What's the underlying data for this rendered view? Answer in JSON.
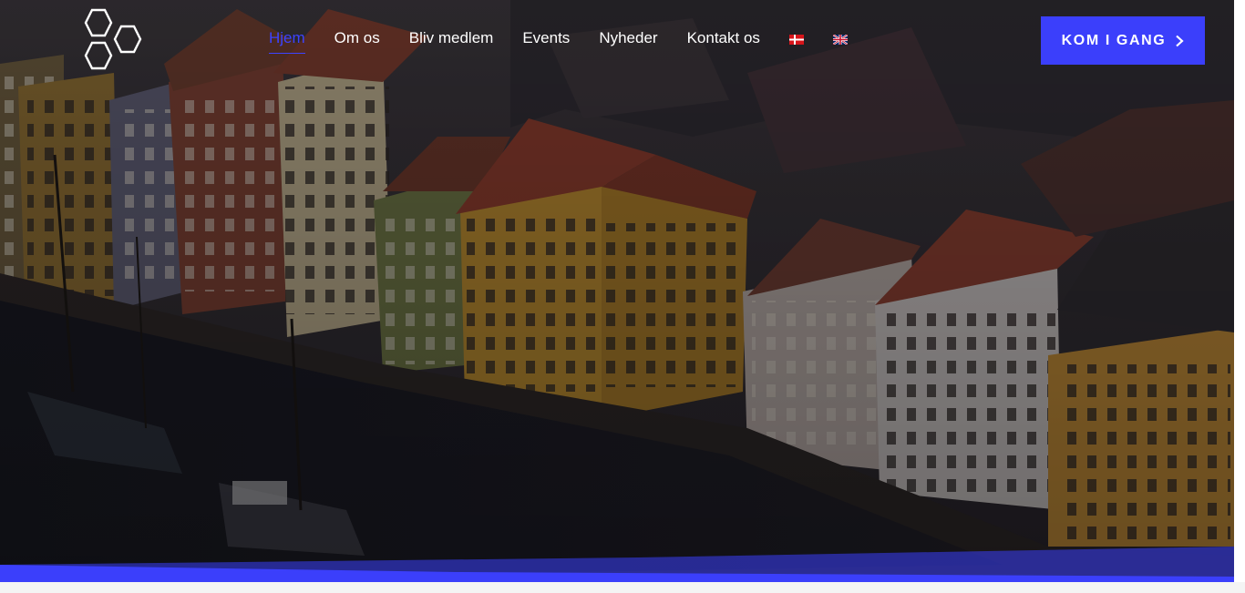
{
  "header": {
    "logo_icon": "hexagon-cluster-logo",
    "nav": [
      {
        "label": "Hjem",
        "active": true
      },
      {
        "label": "Om os",
        "active": false
      },
      {
        "label": "Bliv medlem",
        "active": false
      },
      {
        "label": "Events",
        "active": false
      },
      {
        "label": "Nyheder",
        "active": false
      },
      {
        "label": "Kontakt os",
        "active": false
      }
    ],
    "languages": [
      {
        "code": "da",
        "icon": "danish-flag-icon"
      },
      {
        "code": "en",
        "icon": "uk-flag-icon"
      }
    ],
    "cta_label": "KOM I GANG",
    "cta_icon": "chevron-right-icon"
  },
  "hero": {
    "image": "nyhavn-harbour-photo",
    "accent_color": "#3b3ffb"
  },
  "colors": {
    "active_nav": "#3d43ff",
    "cta_background": "#3b3ffb",
    "nav_text": "#ffffff"
  }
}
